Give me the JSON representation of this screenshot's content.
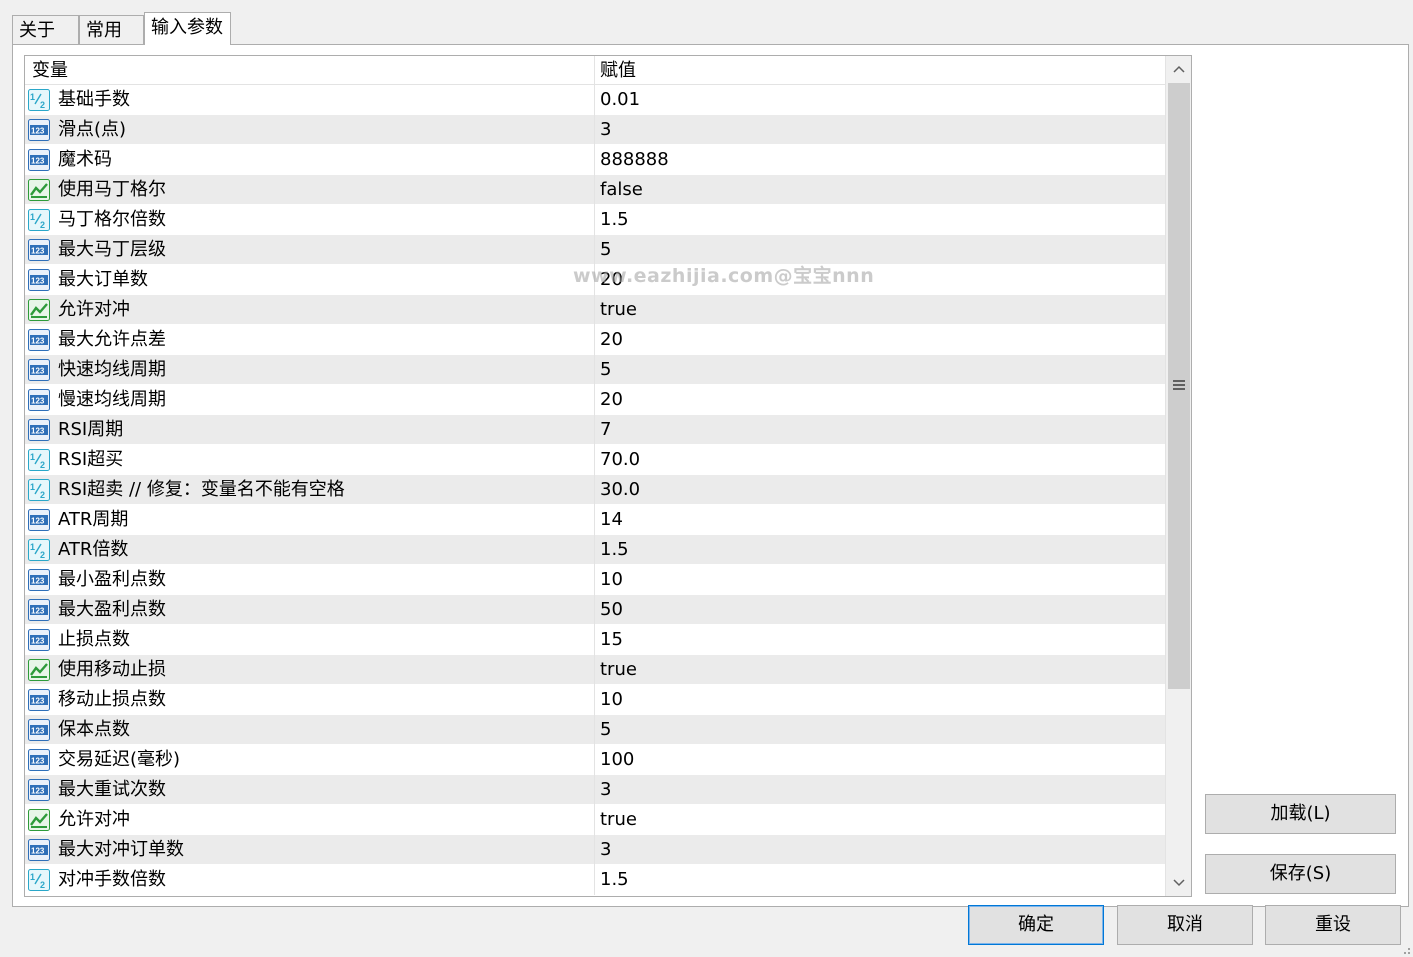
{
  "tabs": [
    {
      "label": "关于"
    },
    {
      "label": "常用"
    },
    {
      "label": "输入参数"
    }
  ],
  "grid": {
    "col_variable": "变量",
    "col_value": "赋值",
    "rows": [
      {
        "type": "double",
        "name": "基础手数",
        "value": "0.01"
      },
      {
        "type": "int",
        "name": "滑点(点)",
        "value": "3"
      },
      {
        "type": "int",
        "name": "魔术码",
        "value": "888888"
      },
      {
        "type": "bool",
        "name": "使用马丁格尔",
        "value": "false"
      },
      {
        "type": "double",
        "name": "马丁格尔倍数",
        "value": "1.5"
      },
      {
        "type": "int",
        "name": "最大马丁层级",
        "value": "5"
      },
      {
        "type": "int",
        "name": "最大订单数",
        "value": "20"
      },
      {
        "type": "bool",
        "name": "允许对冲",
        "value": "true"
      },
      {
        "type": "int",
        "name": "最大允许点差",
        "value": "20"
      },
      {
        "type": "int",
        "name": "快速均线周期",
        "value": "5"
      },
      {
        "type": "int",
        "name": "慢速均线周期",
        "value": "20"
      },
      {
        "type": "int",
        "name": "RSI周期",
        "value": "7"
      },
      {
        "type": "double",
        "name": "RSI超买",
        "value": "70.0"
      },
      {
        "type": "double",
        "name": "RSI超卖 // 修复：变量名不能有空格",
        "value": "30.0"
      },
      {
        "type": "int",
        "name": "ATR周期",
        "value": "14"
      },
      {
        "type": "double",
        "name": "ATR倍数",
        "value": "1.5"
      },
      {
        "type": "int",
        "name": "最小盈利点数",
        "value": "10"
      },
      {
        "type": "int",
        "name": "最大盈利点数",
        "value": "50"
      },
      {
        "type": "int",
        "name": "止损点数",
        "value": "15"
      },
      {
        "type": "bool",
        "name": "使用移动止损",
        "value": "true"
      },
      {
        "type": "int",
        "name": "移动止损点数",
        "value": "10"
      },
      {
        "type": "int",
        "name": "保本点数",
        "value": "5"
      },
      {
        "type": "int",
        "name": "交易延迟(毫秒)",
        "value": "100"
      },
      {
        "type": "int",
        "name": "最大重试次数",
        "value": "3"
      },
      {
        "type": "bool",
        "name": "允许对冲",
        "value": "true"
      },
      {
        "type": "int",
        "name": "最大对冲订单数",
        "value": "3"
      },
      {
        "type": "double",
        "name": "对冲手数倍数",
        "value": "1.5"
      }
    ]
  },
  "side_buttons": {
    "load": "加载(L)",
    "save": "保存(S)"
  },
  "footer_buttons": {
    "ok": "确定",
    "cancel": "取消",
    "reset": "重设"
  },
  "watermark": "www.eazhijia.com@宝宝nnn",
  "colors": {
    "icon_int": "#2f6fb8",
    "icon_double": "#2aa7c9",
    "icon_bool": "#2e9b3a",
    "default_button_border": "#0078d7"
  }
}
